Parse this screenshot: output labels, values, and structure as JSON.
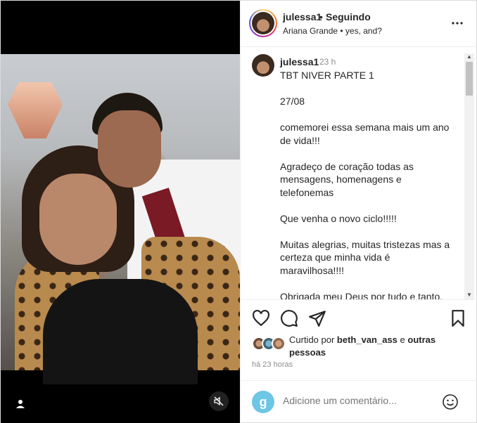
{
  "header": {
    "username": "julessa1",
    "separator": "•",
    "follow_status": "Seguindo",
    "song": "Ariana Grande • yes, and?"
  },
  "caption": {
    "username": "julessa1",
    "time": "23 h",
    "text": "TBT NIVER PARTE 1\n\n27/08\n\ncomemorei essa semana mais um ano de vida!!!\n\nAgradeço de coração todas as mensagens, homenagens e telefonemas\n\nQue venha o novo ciclo!!!!!\n\nMuitas alegrias, muitas tristezas mas a certeza que minha vida é maravilhosa!!!!\n\nObrigada meu Deus por tudo e tanto.\nAmo de paixão minha família e"
  },
  "likes": {
    "prefix": "Curtido por ",
    "user": "beth_van_ass",
    "middle": " e ",
    "others": "outras pessoas"
  },
  "posted_time": "há 23 horas",
  "comment_input": {
    "placeholder": "Adicione um comentário...",
    "avatar_letter": "g"
  },
  "icons": {
    "more": "more-options-icon",
    "like": "heart-icon",
    "comment": "comment-icon",
    "share": "share-icon",
    "save": "bookmark-icon",
    "emoji": "emoji-icon",
    "user_tag": "user-tag-icon",
    "mute": "muted-speaker-icon"
  }
}
